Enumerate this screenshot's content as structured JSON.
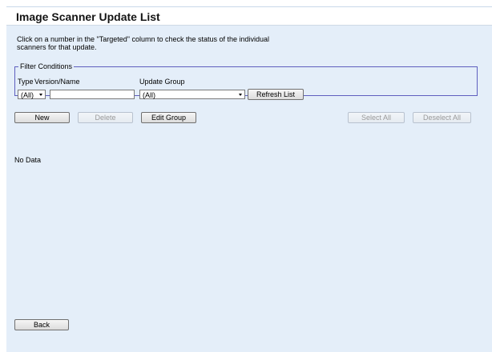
{
  "header": {
    "title": "Image Scanner Update List"
  },
  "description": {
    "line1": "Click on a number in the \"Targeted\" column to check the status of the individual",
    "line2": "scanners for that update."
  },
  "filter": {
    "legend": "Filter Conditions",
    "type_label": "Type",
    "version_label": "Version/Name",
    "group_label": "Update Group",
    "type_value": "(All)",
    "version_value": "",
    "group_value": "(All)",
    "refresh_label": "Refresh List"
  },
  "toolbar": {
    "new_label": "New",
    "delete_label": "Delete",
    "edit_group_label": "Edit Group",
    "select_all_label": "Select All",
    "deselect_all_label": "Deselect All"
  },
  "list": {
    "empty_text": "No Data"
  },
  "footer": {
    "back_label": "Back"
  },
  "colors": {
    "page_background": "#e4eef9",
    "fieldset_border": "#5e5fbf",
    "disabled_text": "#9a9a9a"
  }
}
